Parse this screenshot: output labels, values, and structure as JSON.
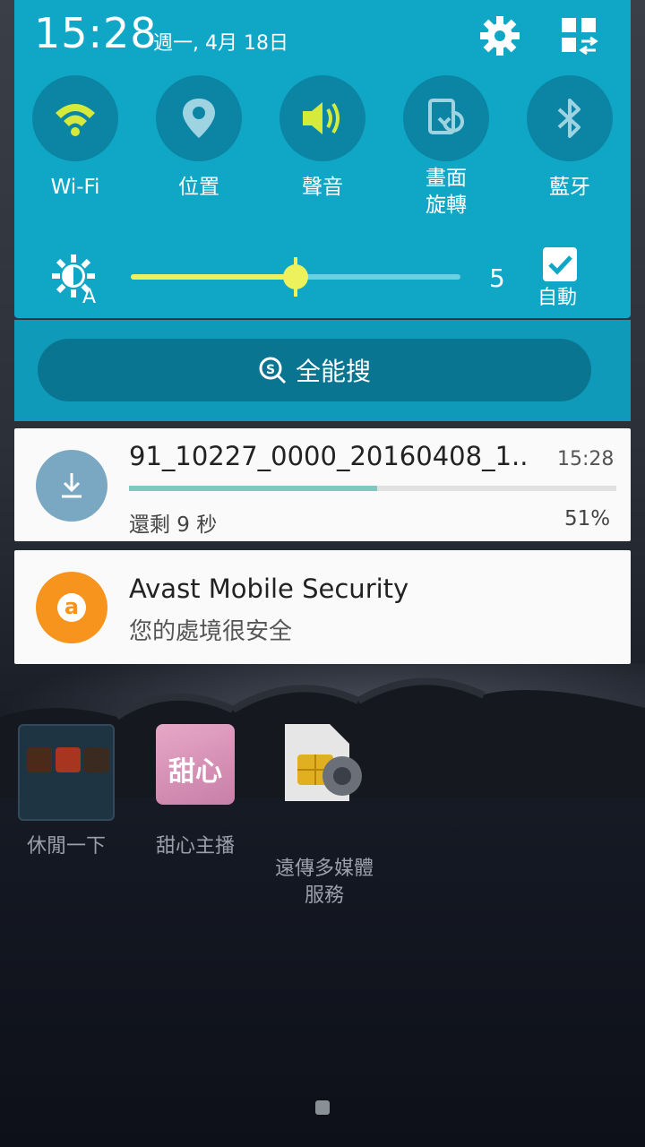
{
  "status": {
    "time": "15:28",
    "date": "週一, 4月 18日"
  },
  "quick_settings": {
    "toggles": [
      {
        "label": "Wi-Fi",
        "icon": "wifi-icon",
        "active": true
      },
      {
        "label": "位置",
        "icon": "location-icon",
        "active": false
      },
      {
        "label": "聲音",
        "icon": "sound-icon",
        "active": true
      },
      {
        "label": "畫面\n旋轉",
        "icon": "rotate-icon",
        "active": false
      },
      {
        "label": "藍牙",
        "icon": "bluetooth-icon",
        "active": false
      }
    ],
    "brightness": {
      "value": "5",
      "level": 0.5,
      "auto_label": "自動",
      "auto_checked": true
    }
  },
  "search": {
    "label": "全能搜"
  },
  "notifications": [
    {
      "title": "91_10227_0000_20160408_1..",
      "time": "15:28",
      "remaining": "還剩 9 秒",
      "percent_text": "51%",
      "progress": 0.51
    },
    {
      "title": "Avast Mobile Security",
      "text": "您的處境很安全"
    }
  ],
  "home": {
    "icons": [
      {
        "label": "休閒一下"
      },
      {
        "label": "甜心主播"
      },
      {
        "label": "遠傳多媒體\n服務"
      }
    ],
    "sweet_logo": "甜心"
  },
  "colors": {
    "panel": "#10a7c7",
    "toggle_bg": "#0b85a3",
    "active_yellow": "#d6ea3c",
    "avast_orange": "#f7941d"
  }
}
